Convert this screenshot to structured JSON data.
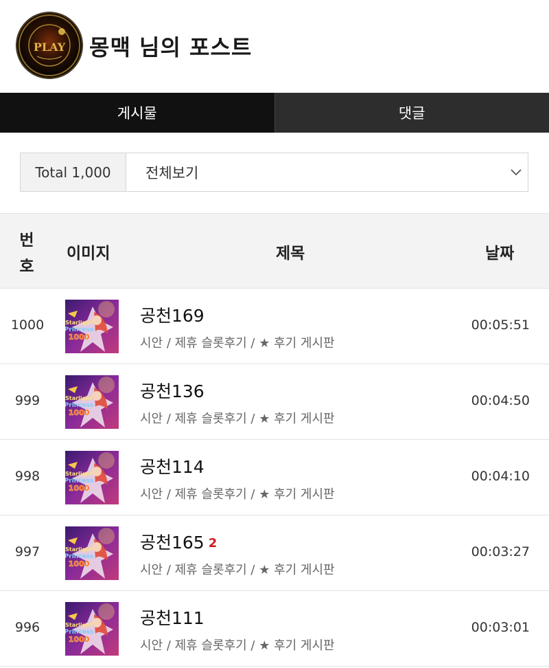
{
  "header": {
    "title": "몽맥 님의 포스트",
    "avatar_icon": "play-logo-avatar",
    "avatar_text": "PLAY"
  },
  "tabs": [
    {
      "label": "게시물",
      "active": true
    },
    {
      "label": "댓글",
      "active": false
    }
  ],
  "filter": {
    "total_label": "Total 1,000",
    "selected": "전체보기"
  },
  "table": {
    "headers": {
      "number_line1": "번",
      "number_line2": "호",
      "image": "이미지",
      "title": "제목",
      "date": "날짜"
    },
    "rows": [
      {
        "no": "1000",
        "title": "공천169",
        "comments": "",
        "category": "시안 / 제휴 슬롯후기 / ★ 후기 게시판",
        "time": "00:05:51"
      },
      {
        "no": "999",
        "title": "공천136",
        "comments": "",
        "category": "시안 / 제휴 슬롯후기 / ★ 후기 게시판",
        "time": "00:04:50"
      },
      {
        "no": "998",
        "title": "공천114",
        "comments": "",
        "category": "시안 / 제휴 슬롯후기 / ★ 후기 게시판",
        "time": "00:04:10"
      },
      {
        "no": "997",
        "title": "공천165",
        "comments": "2",
        "category": "시안 / 제휴 슬롯후기 / ★ 후기 게시판",
        "time": "00:03:27"
      },
      {
        "no": "996",
        "title": "공천111",
        "comments": "",
        "category": "시안 / 제휴 슬롯후기 / ★ 후기 게시판",
        "time": "00:03:01"
      }
    ],
    "thumbnail_icon": "starlight-princess-thumbnail",
    "thumbnail_text": [
      "Starlight",
      "Princess",
      "1000"
    ]
  },
  "colors": {
    "tab_active_bg": "#111111",
    "tab_inactive_bg": "#2d2d2d",
    "comment_count": "#d01c1c",
    "header_bg": "#f3f3f3"
  }
}
